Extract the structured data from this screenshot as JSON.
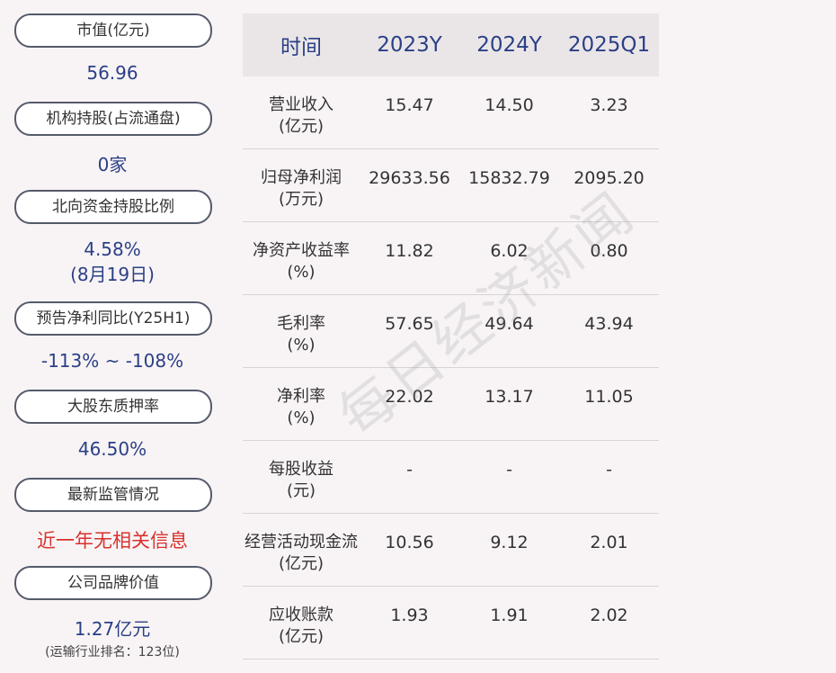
{
  "left_panel": {
    "items": [
      {
        "label": "市值(亿元)",
        "value": "56.96"
      },
      {
        "label": "机构持股(占流通盘)",
        "value": "0家"
      },
      {
        "label": "北向资金持股比例",
        "value": "4.58%",
        "value_line2": "(8月19日)"
      },
      {
        "label": "预告净利同比(Y25H1)",
        "value": "-113% ~ -108%"
      },
      {
        "label": "大股东质押率",
        "value": "46.50%"
      },
      {
        "label": "最新监管情况",
        "value": "近一年无相关信息"
      },
      {
        "label": "公司品牌价值",
        "value": "1.27亿元",
        "note": "(运输行业排名：123位)"
      }
    ],
    "colors": {
      "value": "#2b3f86",
      "alert": "#d8322e"
    }
  },
  "table": {
    "headers": [
      "时间",
      "2023Y",
      "2024Y",
      "2025Q1"
    ],
    "rows": [
      {
        "label": "营业收入",
        "unit": "(亿元)",
        "values": [
          "15.47",
          "14.50",
          "3.23"
        ]
      },
      {
        "label": "归母净利润",
        "unit": "(万元)",
        "values": [
          "29633.56",
          "15832.79",
          "2095.20"
        ]
      },
      {
        "label": "净资产收益率",
        "unit": "(%)",
        "values": [
          "11.82",
          "6.02",
          "0.80"
        ]
      },
      {
        "label": "毛利率",
        "unit": "(%)",
        "values": [
          "57.65",
          "49.64",
          "43.94"
        ]
      },
      {
        "label": "净利率",
        "unit": "(%)",
        "values": [
          "22.02",
          "13.17",
          "11.05"
        ]
      },
      {
        "label": "每股收益",
        "unit": "(元)",
        "values": [
          "-",
          "-",
          "-"
        ]
      },
      {
        "label": "经营活动现金流",
        "unit": "(亿元)",
        "values": [
          "10.56",
          "9.12",
          "2.01"
        ]
      },
      {
        "label": "应收账款",
        "unit": "(亿元)",
        "values": [
          "1.93",
          "1.91",
          "2.02"
        ]
      }
    ]
  },
  "watermark": "每日经济新闻"
}
